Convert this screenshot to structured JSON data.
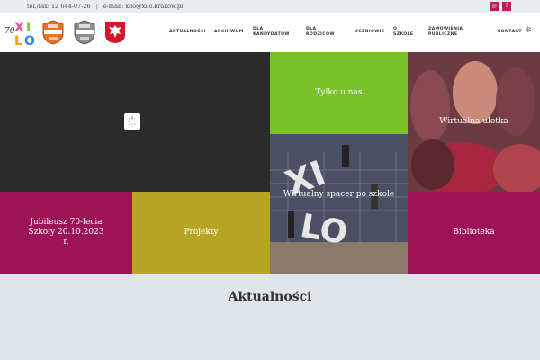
{
  "topbar": {
    "phone": "tel./fax: 12 644-07-26",
    "separator": "|",
    "email": "e-mail: xilo@xilo.krakow.pl",
    "social": [
      {
        "name": "instagram-icon",
        "glyph": "◎"
      },
      {
        "name": "facebook-icon",
        "glyph": "f"
      }
    ]
  },
  "header": {
    "logo_text": "XI LO",
    "badges": [
      "NAJLEPSZE LICEA",
      "NAJLEPSZE LICEA"
    ]
  },
  "nav": {
    "items": [
      "Aktualności",
      "Archiwum",
      "Dla kandydatów",
      "Dla rodziców",
      "Uczniowie",
      "O szkole",
      "Zamówienia publiczne",
      "Kontakt"
    ],
    "settings_glyph": "✻"
  },
  "tiles": {
    "tylko": "Tylko u nas",
    "ulotka": "Wirtualna ulotka",
    "spacer": "Wirtualny spacer po szkole",
    "jubileusz": "Jubileusz 70-lecia Szkoły 20.10.2023 r.",
    "projekty": "Projekty",
    "biblioteka": "Biblioteka"
  },
  "colors": {
    "green": "#7ac22a",
    "magenta": "#9c1356",
    "olive": "#b6a522",
    "social": "#c2185b"
  },
  "main": {
    "section_title": "Aktualności"
  }
}
